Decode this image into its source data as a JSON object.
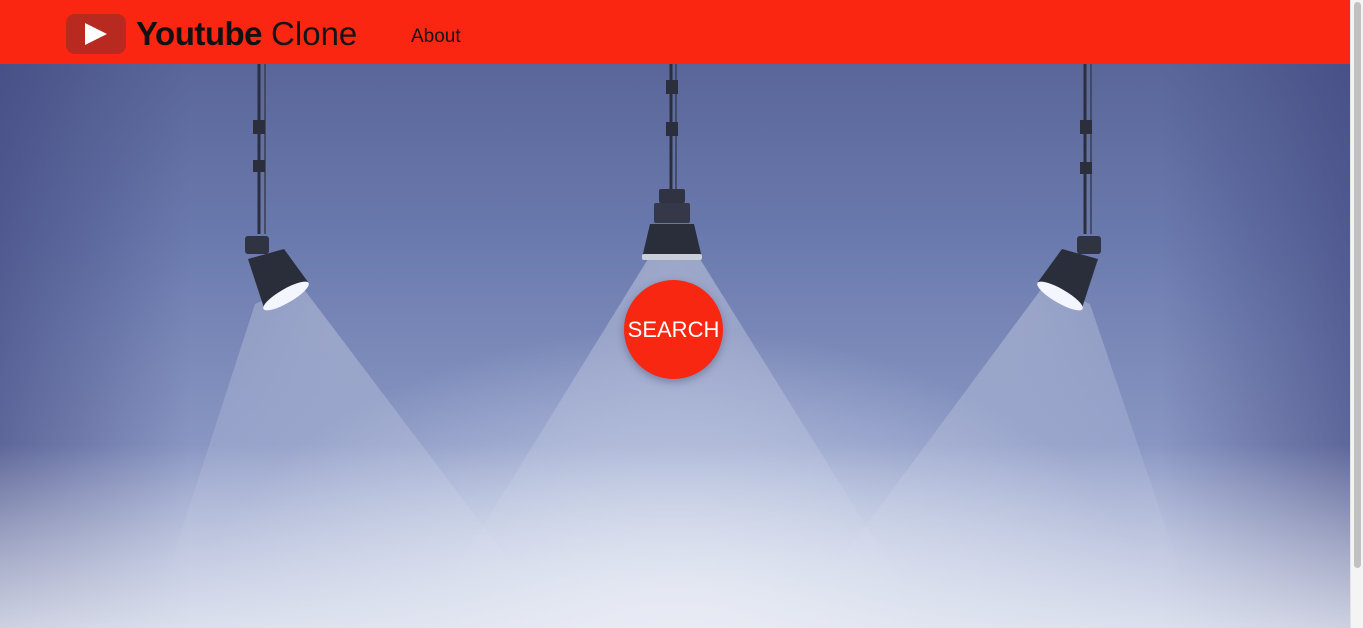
{
  "navbar": {
    "brand_bold": "Youtube",
    "brand_light": "Clone",
    "logo_icon": "play-icon",
    "links": [
      {
        "label": "About"
      }
    ],
    "background_color": "#fa2611"
  },
  "hero": {
    "search_button_label": "SEARCH",
    "search_button_color": "#f72711"
  }
}
